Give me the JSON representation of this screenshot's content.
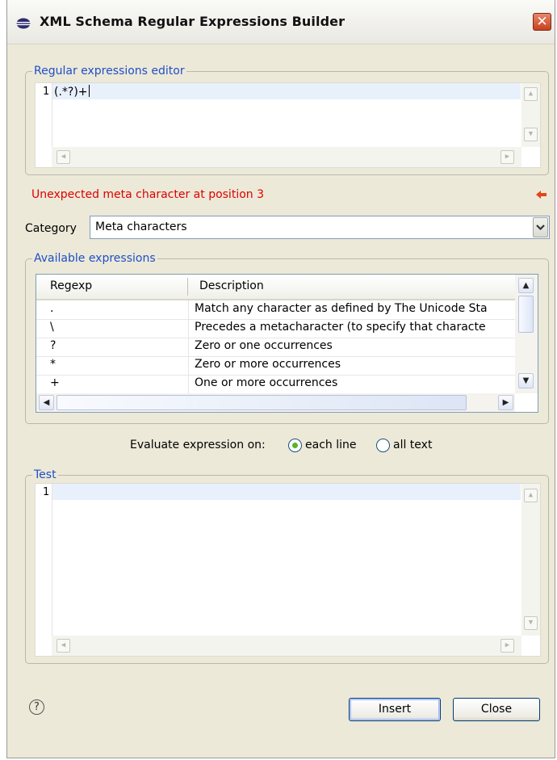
{
  "window": {
    "title": "XML Schema Regular Expressions Builder",
    "close_glyph": "✕"
  },
  "regex_editor": {
    "legend": "Regular expressions editor",
    "line_number": "1",
    "content": "(.*?)+"
  },
  "error": {
    "message": "Unexpected meta character at position 3"
  },
  "category": {
    "label": "Category",
    "value": "Meta characters"
  },
  "available": {
    "legend": "Available expressions",
    "columns": [
      "Regexp",
      "Description"
    ],
    "rows": [
      {
        "regexp": ".",
        "description": "Match any character as defined by The Unicode Sta"
      },
      {
        "regexp": "\\",
        "description": "Precedes a metacharacter (to specify that characte"
      },
      {
        "regexp": "?",
        "description": "Zero or one occurrences"
      },
      {
        "regexp": "*",
        "description": "Zero or more occurrences"
      },
      {
        "regexp": "+",
        "description": "One or more occurrences"
      }
    ]
  },
  "evaluate": {
    "label": "Evaluate expression on:",
    "options": [
      "each line",
      "all text"
    ],
    "selected": "each line"
  },
  "test": {
    "legend": "Test",
    "line_number": "1"
  },
  "buttons": {
    "help": "?",
    "insert": "Insert",
    "close": "Close"
  },
  "colors": {
    "legend": "#1f4ec9",
    "error": "#e00000",
    "dialog_bg": "#ece9d8",
    "current_line": "#e8f0fb"
  }
}
